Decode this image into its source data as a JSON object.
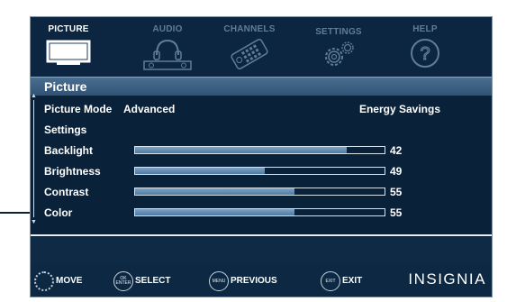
{
  "tabs": [
    {
      "label": "PICTURE",
      "icon": "tv-icon",
      "active": true
    },
    {
      "label": "AUDIO",
      "icon": "headphones-speaker-icon",
      "active": false
    },
    {
      "label": "CHANNELS",
      "icon": "remote-control-icon",
      "active": false
    },
    {
      "label": "SETTINGS",
      "icon": "gears-icon",
      "active": false
    },
    {
      "label": "HELP",
      "icon": "question-icon",
      "active": false
    }
  ],
  "menu": {
    "title": "Picture",
    "rows": {
      "picture_mode": {
        "label": "Picture Mode",
        "value": "Advanced",
        "extra": "Energy Savings"
      },
      "settings": {
        "label": "Settings"
      },
      "backlight": {
        "label": "Backlight",
        "value": 42
      },
      "brightness": {
        "label": "Brightness",
        "value": 49
      },
      "contrast": {
        "label": "Contrast",
        "value": 55
      },
      "color": {
        "label": "Color",
        "value": 55
      }
    },
    "bar_fill_fraction": {
      "backlight": 0.85,
      "brightness": 0.52,
      "contrast": 0.64,
      "color": 0.64
    }
  },
  "footer": {
    "hints": [
      {
        "button": "",
        "label": "MOVE",
        "icon": "dpad-icon"
      },
      {
        "button": "OK ENTER",
        "label": "SELECT",
        "icon": "ok-enter-icon"
      },
      {
        "button": "MENU",
        "label": "PREVIOUS",
        "icon": "menu-button-icon"
      },
      {
        "button": "EXIT",
        "label": "EXIT",
        "icon": "exit-button-icon"
      }
    ],
    "brand": "INSIGNIA"
  },
  "colors": {
    "background": "#0e2a45",
    "accent": "#4a6f91",
    "bar_fill": "#6d95b9",
    "inactive_tab": "#5f7d99"
  }
}
